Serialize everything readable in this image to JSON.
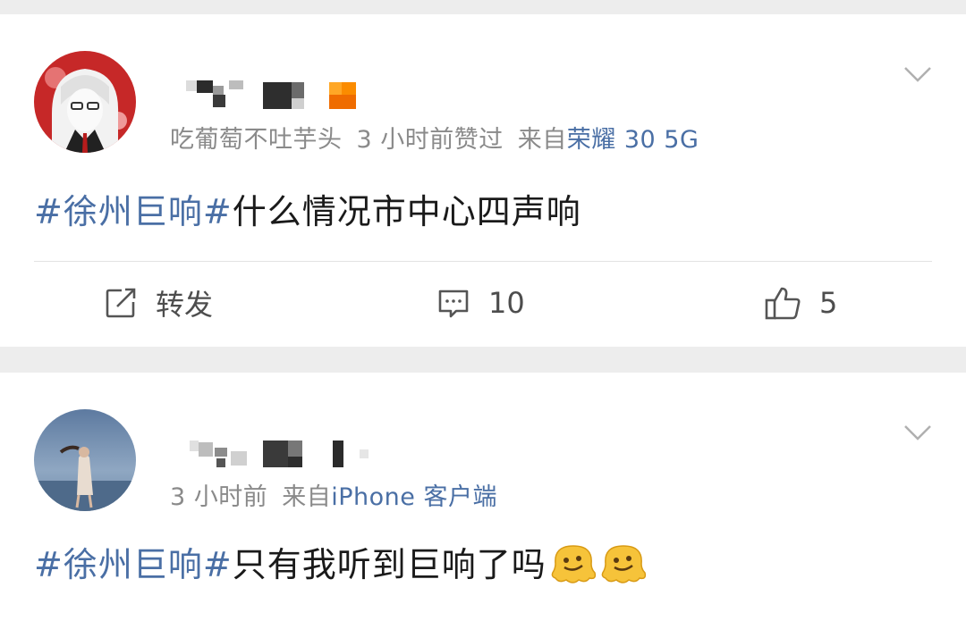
{
  "posts": [
    {
      "meta_user": "吃葡萄不吐芋头",
      "meta_time": "3 小时前赞过",
      "meta_from": "来自",
      "meta_device": "荣耀 30 5G",
      "hashtag": "#徐州巨响#",
      "text": "什么情况市中心四声响",
      "actions": {
        "repost_label": "转发",
        "comment_count": "10",
        "like_count": "5"
      }
    },
    {
      "meta_time": "3 小时前",
      "meta_from": "来自",
      "meta_device": "iPhone 客户端",
      "hashtag": "#徐州巨响#",
      "text": "只有我听到巨响了吗",
      "emoji_count": 2
    }
  ],
  "icons": {
    "repost": "edit-share-icon",
    "comment": "comment-icon",
    "like": "thumbs-up-icon",
    "more": "chevron-down-icon"
  },
  "colors": {
    "link": "#4a6fa5",
    "meta": "#8a8a8a",
    "text": "#1a1a1a",
    "background": "#ededed"
  }
}
